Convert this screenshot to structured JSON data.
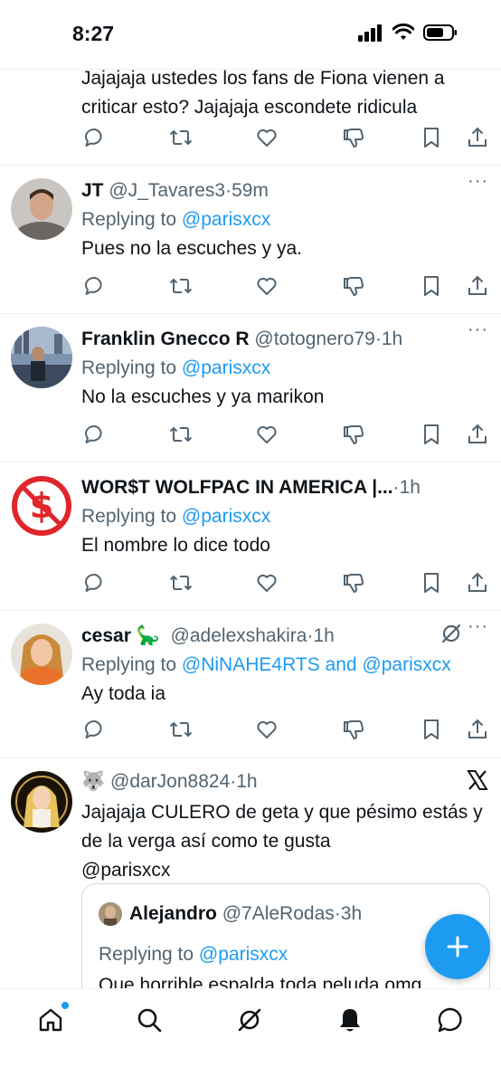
{
  "status": {
    "time": "8:27"
  },
  "tweets": [
    {
      "text": "Jajajaja ustedes los fans de Fiona vienen a criticar esto? Jajajaja escondete ridicula"
    },
    {
      "name": "JT",
      "handle": "@J_Tavares3",
      "time": "59m",
      "replying_label": "Replying to",
      "mentions": "@parisxcx",
      "text": "Pues no la escuches y ya."
    },
    {
      "name": "Franklin Gnecco R",
      "handle": "@totognero79",
      "time": "1h",
      "replying_label": "Replying to",
      "mentions": "@parisxcx",
      "text": "No la escuches y ya marikon"
    },
    {
      "name": "WOR$T WOLFPAC IN AMERICA |...",
      "time": "1h",
      "replying_label": "Replying to",
      "mentions": "@parisxcx",
      "text": "El nombre lo dice todo"
    },
    {
      "name": "cesar 🦕",
      "handle": "@adelexshakira",
      "time": "1h",
      "replying_label": "Replying to",
      "mentions": "@NiNAHE4RTS and @parisxcx",
      "text": "Ay toda ia"
    },
    {
      "name": "🐺",
      "handle": "@darJon8824",
      "time": "1h",
      "text": "Jajajaja CULERO de geta y que pésimo estás y de la verga así como te gusta",
      "mention_line": "@parisxcx",
      "quote": {
        "name": "Alejandro",
        "handle": "@7AleRodas",
        "time": "3h",
        "replying_label": "Replying to",
        "mentions": "@parisxcx",
        "text": "Que horrible espalda toda peluda omg"
      }
    }
  ],
  "separator": "·",
  "more": "···",
  "colors": {
    "accent": "#1d9bf0",
    "muted": "#536471",
    "text": "#0f1419"
  },
  "nav": [
    "home-icon",
    "search-icon",
    "grok-icon",
    "notifications-icon",
    "messages-icon"
  ]
}
